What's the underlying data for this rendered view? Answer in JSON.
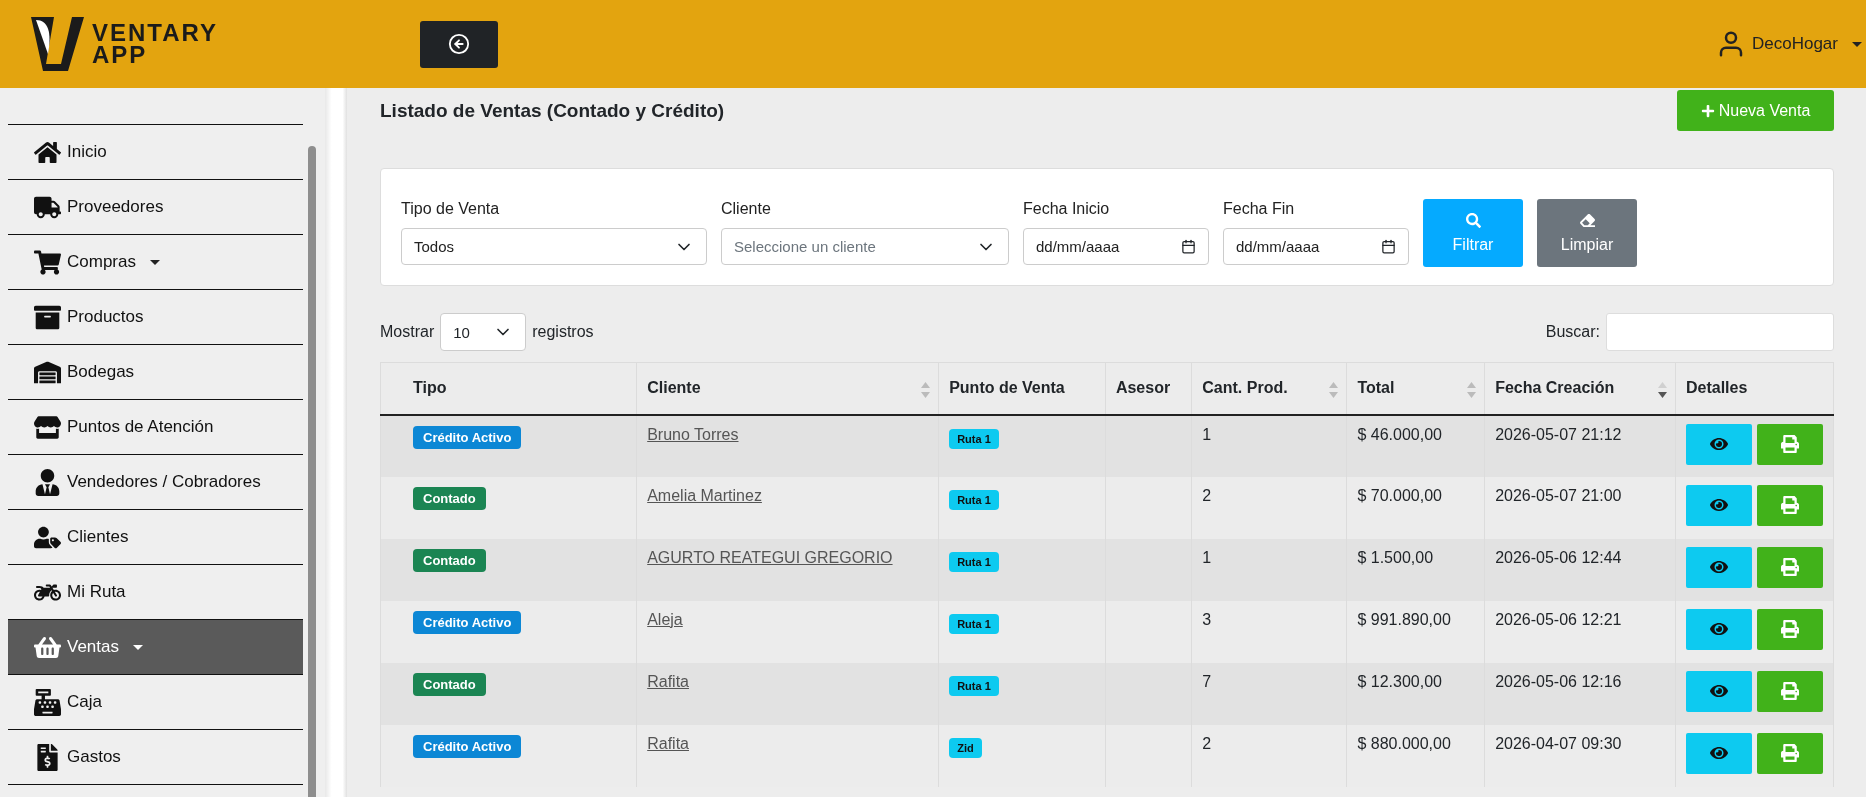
{
  "header": {
    "logo_top": "VENTARY",
    "logo_bottom": "APP",
    "user": "DecoHogar"
  },
  "sidebar": {
    "items": [
      {
        "label": "Inicio",
        "dropdown": false,
        "selected": false
      },
      {
        "label": "Proveedores",
        "dropdown": false,
        "selected": false
      },
      {
        "label": "Compras",
        "dropdown": true,
        "selected": false
      },
      {
        "label": "Productos",
        "dropdown": false,
        "selected": false
      },
      {
        "label": "Bodegas",
        "dropdown": false,
        "selected": false
      },
      {
        "label": "Puntos de Atención",
        "dropdown": false,
        "selected": false
      },
      {
        "label": "Vendedores / Cobradores",
        "dropdown": false,
        "selected": false
      },
      {
        "label": "Clientes",
        "dropdown": false,
        "selected": false
      },
      {
        "label": "Mi Ruta",
        "dropdown": false,
        "selected": false
      },
      {
        "label": "Ventas",
        "dropdown": true,
        "selected": true
      },
      {
        "label": "Caja",
        "dropdown": false,
        "selected": false
      },
      {
        "label": "Gastos",
        "dropdown": false,
        "selected": false
      }
    ]
  },
  "page": {
    "title": "Listado de Ventas (Contado y Crédito)",
    "new_button": "Nueva Venta"
  },
  "filters": {
    "fields": [
      {
        "kind": "select",
        "label": "Tipo de Venta",
        "value": "Todos"
      },
      {
        "kind": "select",
        "label": "Cliente",
        "placeholder": "Seleccione un cliente"
      },
      {
        "kind": "date",
        "label": "Fecha Inicio",
        "placeholder": "dd/mm/aaaa"
      },
      {
        "kind": "date",
        "label": "Fecha Fin",
        "placeholder": "dd/mm/aaaa"
      }
    ],
    "filter_button": "Filtrar",
    "clear_button": "Limpiar"
  },
  "table_controls": {
    "show_label": "Mostrar",
    "page_size": "10",
    "records_label": "registros",
    "search_label": "Buscar:"
  },
  "table": {
    "columns": [
      {
        "label": "Tipo",
        "sortable": false
      },
      {
        "label": "Cliente",
        "sortable": true,
        "sorted_desc": false
      },
      {
        "label": "Punto de Venta",
        "sortable": false
      },
      {
        "label": "Asesor",
        "sortable": false
      },
      {
        "label": "Cant. Prod.",
        "sortable": true,
        "sorted_desc": false
      },
      {
        "label": "Total",
        "sortable": true,
        "sorted_desc": false
      },
      {
        "label": "Fecha Creación",
        "sortable": true,
        "sorted_desc": true
      },
      {
        "label": "Detalles",
        "sortable": false
      }
    ],
    "rows": [
      {
        "tipo": {
          "label": "Crédito Activo",
          "color": "#0c87d5"
        },
        "cliente": "Bruno Torres",
        "punto": "Ruta 1",
        "cantidad": "1",
        "total": "$ 46.000,00",
        "fecha": "2026-05-07 21:12"
      },
      {
        "tipo": {
          "label": "Contado",
          "color": "#1b8553"
        },
        "cliente": "Amelia Martinez",
        "punto": "Ruta 1",
        "cantidad": "2",
        "total": "$ 70.000,00",
        "fecha": "2026-05-07 21:00"
      },
      {
        "tipo": {
          "label": "Contado",
          "color": "#1b8553"
        },
        "cliente": "AGURTO REATEGUI GREGORIO",
        "punto": "Ruta 1",
        "cantidad": "1",
        "total": "$ 1.500,00",
        "fecha": "2026-05-06 12:44"
      },
      {
        "tipo": {
          "label": "Crédito Activo",
          "color": "#0c87d5"
        },
        "cliente": "Aleja",
        "punto": "Ruta 1",
        "cantidad": "3",
        "total": "$ 991.890,00",
        "fecha": "2026-05-06 12:21"
      },
      {
        "tipo": {
          "label": "Contado",
          "color": "#1b8553"
        },
        "cliente": "Rafita",
        "punto": "Ruta 1",
        "cantidad": "7",
        "total": "$ 12.300,00",
        "fecha": "2026-05-06 12:16"
      },
      {
        "tipo": {
          "label": "Crédito Activo",
          "color": "#0c87d5"
        },
        "cliente": "Rafita",
        "punto": "Zid",
        "cantidad": "2",
        "total": "$ 880.000,00",
        "fecha": "2026-04-07 09:30"
      }
    ]
  }
}
